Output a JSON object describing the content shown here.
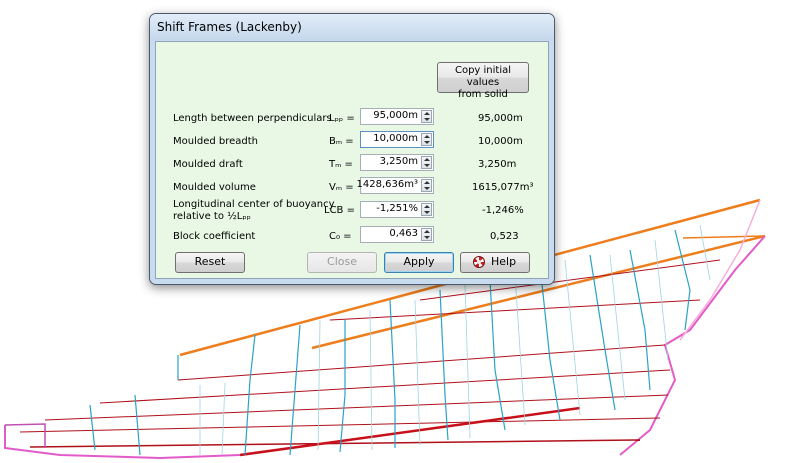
{
  "dialog": {
    "title": "Shift Frames (Lackenby)",
    "copy_button_line1": "Copy initial values",
    "copy_button_line2": "from solid",
    "rows": [
      {
        "label": "Length between perpendiculars",
        "symbol": "Lₚₚ =",
        "input": "95,000m",
        "result": "95,000m"
      },
      {
        "label": "Moulded breadth",
        "symbol": "Bₘ =",
        "input": "10,000m",
        "result": "10,000m"
      },
      {
        "label": "Moulded draft",
        "symbol": "Tₘ =",
        "input": "3,250m",
        "result": "3,250m"
      },
      {
        "label": "Moulded volume",
        "symbol": "Vₘ =",
        "input": "1428,636m³",
        "result": "1615,077m³"
      },
      {
        "label_line1": "Longitudinal center of buoyancy",
        "label_line2": "relative to ½Lₚₚ",
        "symbol": "LCB =",
        "input": "-1,251%",
        "result": "-1,246%"
      },
      {
        "label": "Block coefficient",
        "symbol": "C₀ =",
        "input": "0,463",
        "result": "0,523"
      }
    ],
    "buttons": {
      "reset": "Reset",
      "close": "Close",
      "apply": "Apply",
      "help": "Help"
    }
  },
  "colors": {
    "client_bg": "#e8f8e5",
    "hull_red": "#b0101a",
    "hull_orange": "#ee7d1c",
    "hull_cyan": "#2aa3c4",
    "hull_magenta": "#e35bc9"
  }
}
